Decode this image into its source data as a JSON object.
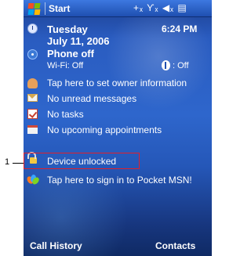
{
  "callout": {
    "number": "1"
  },
  "titlebar": {
    "title": "Start",
    "status_icons": "+ₓ Ƴₓ ◀ₓ ▤"
  },
  "today": {
    "date_day": "Tuesday",
    "date_full": "July 11, 2006",
    "time": "6:24 PM"
  },
  "phone": {
    "status": "Phone off",
    "wifi": "Wi-Fi: Off",
    "bluetooth": ": Off"
  },
  "items": {
    "owner": "Tap here to set owner information",
    "messages": "No unread messages",
    "tasks": "No tasks",
    "appointments": "No upcoming appointments",
    "device": "Device unlocked",
    "msn": "Tap here to sign in to Pocket MSN!"
  },
  "softkeys": {
    "left": "Call History",
    "right": "Contacts"
  },
  "colors": {
    "titlebar": "#1f4fb0",
    "background": "#2a5cc0",
    "highlight": "#e0202a"
  },
  "icons": [
    "windows-start-flag-icon",
    "clock-icon",
    "phone-icon",
    "bluetooth-icon",
    "owner-icon",
    "message-icon",
    "task-icon",
    "calendar-icon",
    "lock-icon",
    "msn-butterfly-icon"
  ]
}
